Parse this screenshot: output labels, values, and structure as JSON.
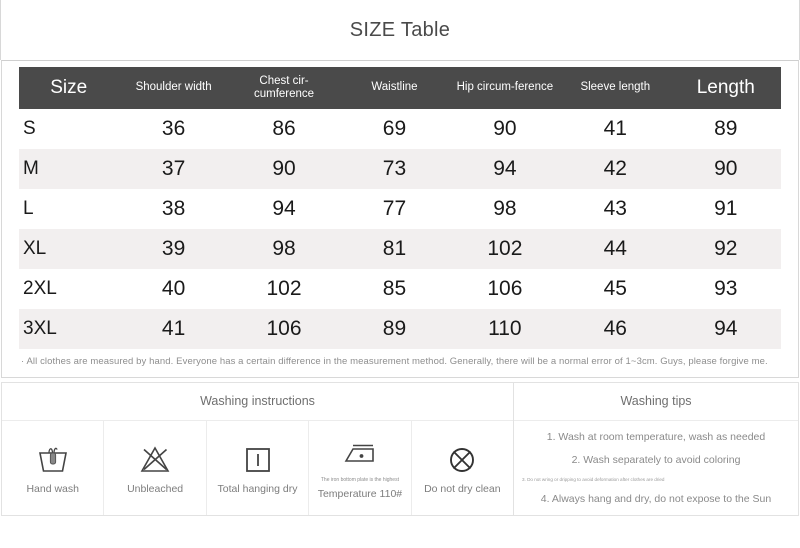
{
  "title": "SIZE Table",
  "table": {
    "headers": [
      "Size",
      "Shoulder width",
      "Chest cir-cumference",
      "Waistline",
      "Hip circum-ference",
      "Sleeve length",
      "Length"
    ],
    "rows": [
      {
        "size": "S",
        "shoulder": "36",
        "chest": "86",
        "waist": "69",
        "hip": "90",
        "sleeve": "41",
        "length": "89"
      },
      {
        "size": "M",
        "shoulder": "37",
        "chest": "90",
        "waist": "73",
        "hip": "94",
        "sleeve": "42",
        "length": "90"
      },
      {
        "size": "L",
        "shoulder": "38",
        "chest": "94",
        "waist": "77",
        "hip": "98",
        "sleeve": "43",
        "length": "91"
      },
      {
        "size": "XL",
        "shoulder": "39",
        "chest": "98",
        "waist": "81",
        "hip": "102",
        "sleeve": "44",
        "length": "92"
      },
      {
        "size": "2XL",
        "shoulder": "40",
        "chest": "102",
        "waist": "85",
        "hip": "106",
        "sleeve": "45",
        "length": "93"
      },
      {
        "size": "3XL",
        "shoulder": "41",
        "chest": "106",
        "waist": "89",
        "hip": "110",
        "sleeve": "46",
        "length": "94"
      }
    ]
  },
  "note": "· All clothes are measured by hand. Everyone has a certain difference in the measurement method. Generally, there will be a normal error of 1~3cm. Guys, please forgive me.",
  "washing_instructions": {
    "heading": "Washing instructions",
    "items": [
      {
        "icon": "hand-wash-icon",
        "label": "Hand wash",
        "sub": ""
      },
      {
        "icon": "unbleached-icon",
        "label": "Unbleached",
        "sub": ""
      },
      {
        "icon": "hanging-dry-icon",
        "label": "Total hanging dry",
        "sub": ""
      },
      {
        "icon": "iron-icon",
        "label": "The iron bottom plate is the highest",
        "sub": "Temperature 110#"
      },
      {
        "icon": "do-not-dry-clean-icon",
        "label": "Do not dry clean",
        "sub": ""
      }
    ]
  },
  "washing_tips": {
    "heading": "Washing tips",
    "items": [
      "1. Wash at room temperature, wash as needed",
      "2. Wash separately to avoid coloring",
      "3. Do not wring or dripping to avoid deformation after clothes are dried",
      "4. Always hang and dry, do not expose to the Sun"
    ]
  },
  "colors": {
    "header_bar": "#4a4a4a",
    "alt_row": "#f2efef",
    "text": "#1a1a1a",
    "muted": "#8a8a8a"
  }
}
